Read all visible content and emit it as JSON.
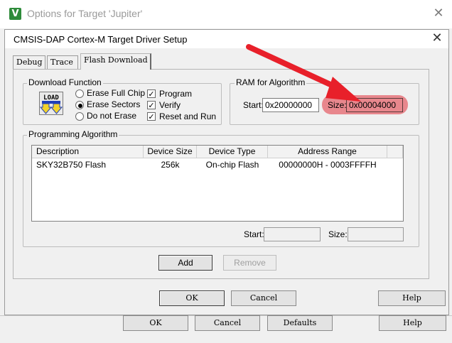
{
  "outer_window": {
    "title": "Options for Target 'Jupiter'",
    "close_glyph": "✕",
    "app_icon_glyph": "V",
    "app_icon_name": "keil-uvision-icon"
  },
  "dialog": {
    "title": "CMSIS-DAP Cortex-M Target Driver Setup",
    "close_glyph": "✕"
  },
  "tabs": [
    {
      "label": "Debug",
      "active": false
    },
    {
      "label": "Trace",
      "active": false
    },
    {
      "label": "Flash Download",
      "active": true
    }
  ],
  "download_function": {
    "title": "Download Function",
    "icon_text": "LOAD",
    "radios": [
      {
        "label": "Erase Full Chip",
        "selected": false
      },
      {
        "label": "Erase Sectors",
        "selected": true
      },
      {
        "label": "Do not Erase",
        "selected": false
      }
    ],
    "checks": [
      {
        "label": "Program",
        "checked": true
      },
      {
        "label": "Verify",
        "checked": true
      },
      {
        "label": "Reset and Run",
        "checked": true
      }
    ],
    "check_glyph": "✓"
  },
  "ram_for_algorithm": {
    "title": "RAM for Algorithm",
    "start_label": "Start:",
    "start_value": "0x20000000",
    "size_label": "Size:",
    "size_value": "0x00004000",
    "highlight_color": "#e8878d",
    "annotation_arrow_color": "#e8202a"
  },
  "programming_algorithm": {
    "title": "Programming Algorithm",
    "columns": [
      "Description",
      "Device Size",
      "Device Type",
      "Address Range"
    ],
    "rows": [
      {
        "description": "SKY32B750 Flash",
        "device_size": "256k",
        "device_type": "On-chip Flash",
        "address_range": "00000000H - 0003FFFFH"
      }
    ],
    "start_label": "Start:",
    "start_value": "",
    "size_label": "Size:",
    "size_value": ""
  },
  "buttons": {
    "add": "Add",
    "remove": "Remove",
    "ok": "OK",
    "cancel": "Cancel",
    "help": "Help",
    "outer_ok": "OK",
    "outer_cancel": "Cancel",
    "outer_defaults": "Defaults",
    "outer_help": "Help"
  }
}
